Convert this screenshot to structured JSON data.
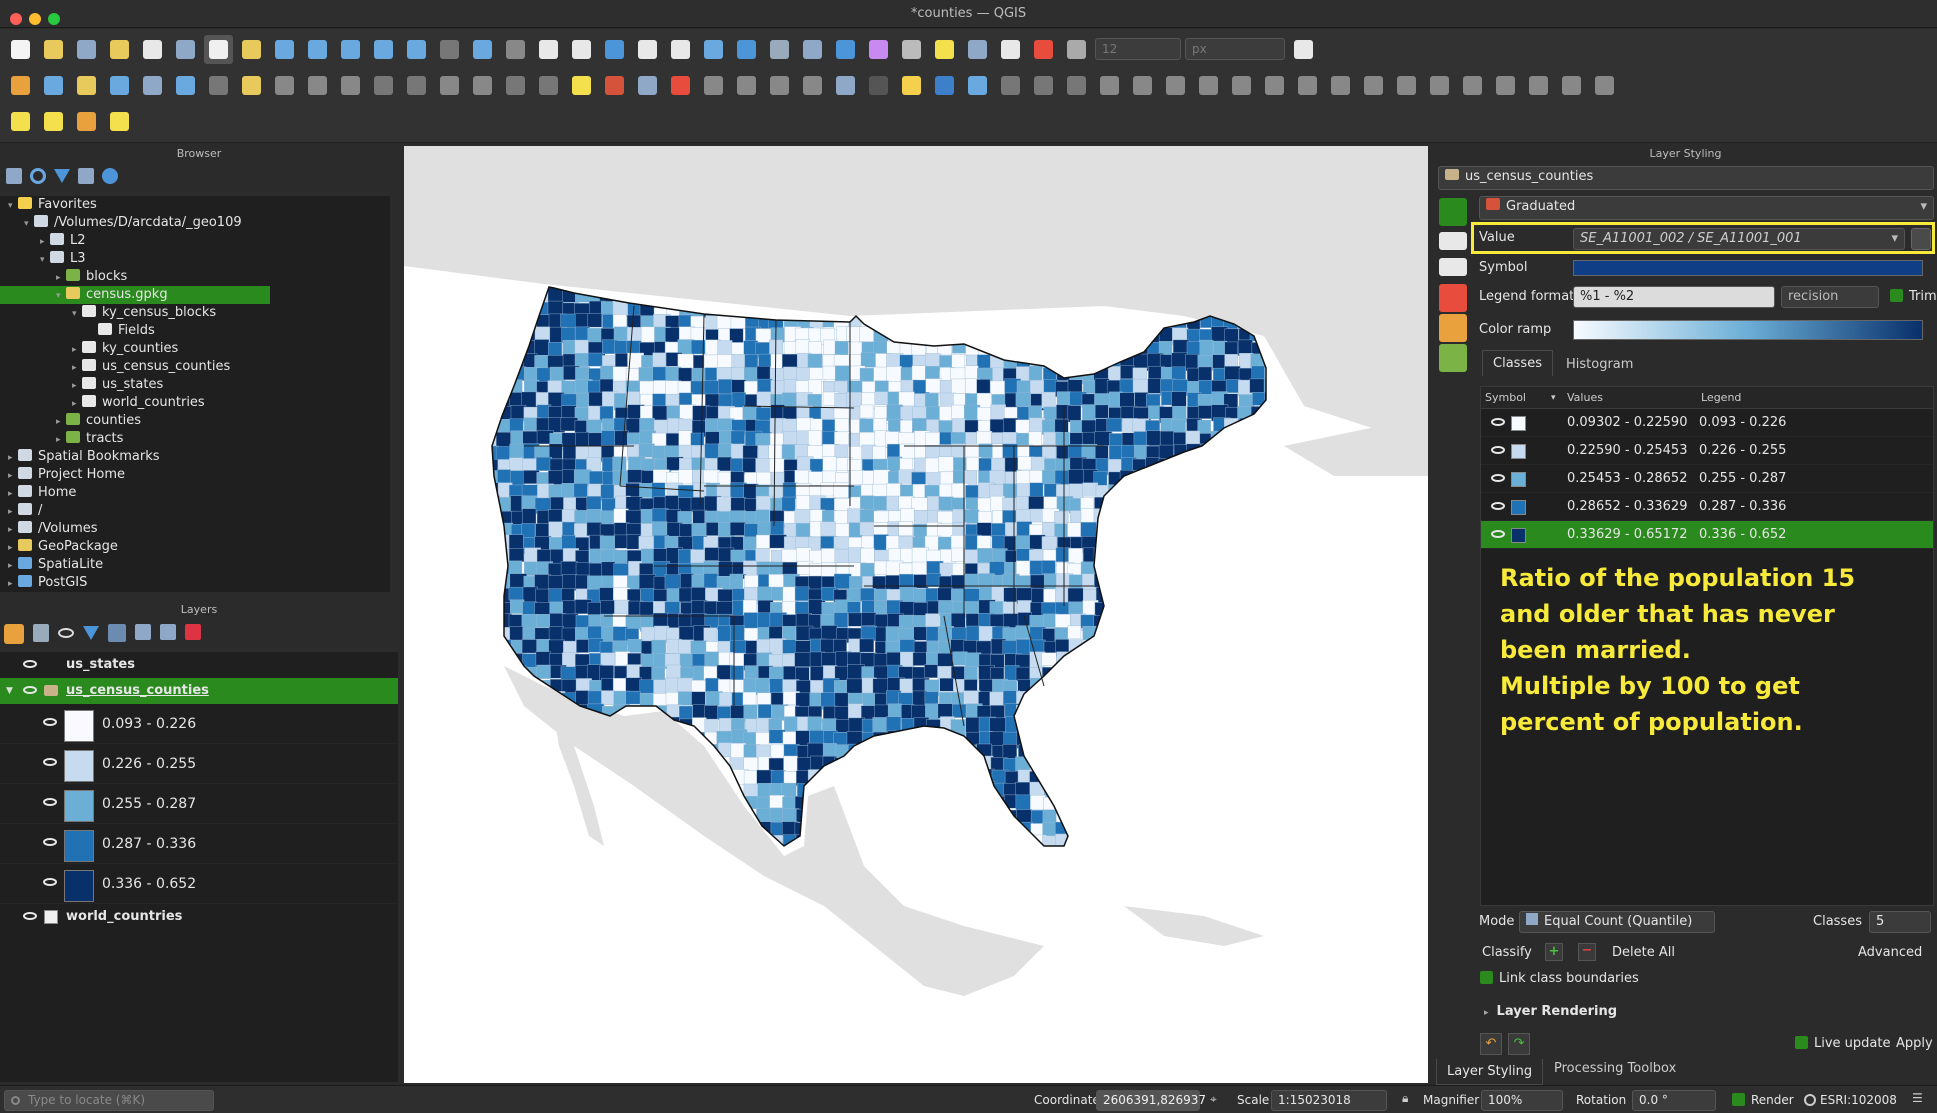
{
  "window": {
    "title": "*counties — QGIS"
  },
  "toolbar": {
    "font_size": "12",
    "unit": "px"
  },
  "browser": {
    "title": "Browser",
    "items": [
      {
        "label": "Favorites",
        "indent": 0,
        "icon": "star-icon"
      },
      {
        "label": "/Volumes/D/arcdata/_geo109",
        "indent": 1,
        "icon": "folder-icon"
      },
      {
        "label": "L2",
        "indent": 2,
        "icon": "folder-icon"
      },
      {
        "label": "L3",
        "indent": 2,
        "icon": "folder-icon"
      },
      {
        "label": "blocks",
        "indent": 3,
        "icon": "qgis-icon"
      },
      {
        "label": "census.gpkg",
        "indent": 3,
        "icon": "geopackage-icon"
      },
      {
        "label": "ky_census_blocks",
        "indent": 4,
        "icon": "polygon-layer-icon"
      },
      {
        "label": "Fields",
        "indent": 5,
        "icon": "table-icon"
      },
      {
        "label": "ky_counties",
        "indent": 4,
        "icon": "polygon-layer-icon"
      },
      {
        "label": "us_census_counties",
        "indent": 4,
        "icon": "polygon-layer-icon"
      },
      {
        "label": "us_states",
        "indent": 4,
        "icon": "polygon-layer-icon"
      },
      {
        "label": "world_countries",
        "indent": 4,
        "icon": "polygon-layer-icon"
      },
      {
        "label": "counties",
        "indent": 3,
        "icon": "qgis-icon"
      },
      {
        "label": "tracts",
        "indent": 3,
        "icon": "qgis-icon"
      },
      {
        "label": "Spatial Bookmarks",
        "indent": 0,
        "icon": "bookmark-icon"
      },
      {
        "label": "Project Home",
        "indent": 0,
        "icon": "folder-icon"
      },
      {
        "label": "Home",
        "indent": 0,
        "icon": "folder-icon"
      },
      {
        "label": "/",
        "indent": 0,
        "icon": "folder-icon"
      },
      {
        "label": "/Volumes",
        "indent": 0,
        "icon": "folder-icon"
      },
      {
        "label": "GeoPackage",
        "indent": 0,
        "icon": "geopackage-icon"
      },
      {
        "label": "SpatiaLite",
        "indent": 0,
        "icon": "spatialite-icon"
      },
      {
        "label": "PostGIS",
        "indent": 0,
        "icon": "postgis-icon"
      }
    ]
  },
  "layers": {
    "title": "Layers",
    "items": [
      {
        "name": "us_states"
      },
      {
        "name": "us_census_counties"
      }
    ],
    "legend": [
      "0.093 - 0.226",
      "0.226 - 0.255",
      "0.255 - 0.287",
      "0.287 - 0.336",
      "0.336 - 0.652"
    ],
    "legend_colors": [
      "#f7fbff",
      "#c6dbef",
      "#6baed6",
      "#2171b5",
      "#08306b"
    ],
    "last": "world_countries"
  },
  "styling": {
    "title": "Layer Styling",
    "layer": "us_census_counties",
    "renderer": "Graduated",
    "value_label": "Value",
    "value": "SE_A11001_002 / SE_A11001_001",
    "symbol_label": "Symbol",
    "legend_format_label": "Legend format",
    "legend_format": "%1 - %2",
    "precision": "recision",
    "trim": "Trim",
    "color_ramp_label": "Color ramp",
    "tabs": [
      "Classes",
      "Histogram"
    ],
    "columns": [
      "Symbol",
      "Values",
      "Legend"
    ],
    "classes": [
      {
        "values": "0.09302 - 0.22590",
        "legend": "0.093 - 0.226"
      },
      {
        "values": "0.22590 - 0.25453",
        "legend": "0.226 - 0.255"
      },
      {
        "values": "0.25453 - 0.28652",
        "legend": "0.255 - 0.287"
      },
      {
        "values": "0.28652 - 0.33629",
        "legend": "0.287 - 0.336"
      },
      {
        "values": "0.33629 - 0.65172",
        "legend": "0.336 - 0.652"
      }
    ],
    "note": [
      "Ratio of the population 15",
      "and older that has never",
      "been married.",
      "Multiple by 100 to get",
      "percent of population."
    ],
    "mode_label": "Mode",
    "mode": "Equal Count (Quantile)",
    "classes_label": "Classes",
    "classes_count": "5",
    "classify": "Classify",
    "delete_all": "Delete All",
    "advanced": "Advanced",
    "link_boundaries": "Link class boundaries",
    "layer_rendering": "Layer Rendering",
    "live_update": "Live update",
    "apply": "Apply",
    "bottom_tabs": [
      "Layer Styling",
      "Processing Toolbox"
    ]
  },
  "status": {
    "locate_placeholder": "Type to locate (⌘K)",
    "coordinate_label": "Coordinate",
    "coordinate": "2606391,826937",
    "scale_label": "Scale",
    "scale": "1:15023018",
    "magnifier_label": "Magnifier",
    "magnifier": "100%",
    "rotation_label": "Rotation",
    "rotation": "0.0 °",
    "render": "Render",
    "crs": "ESRI:102008"
  }
}
